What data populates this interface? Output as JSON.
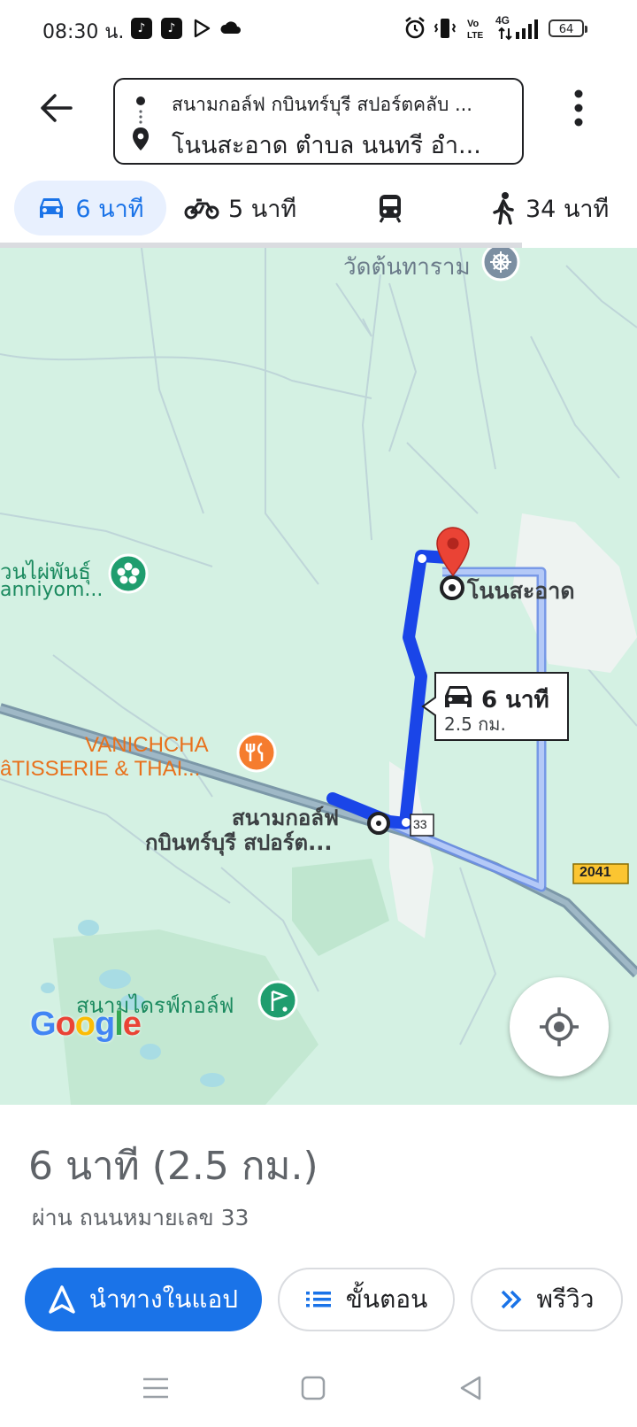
{
  "status_bar": {
    "time": "08:30 น.",
    "network": "4G",
    "battery": "64",
    "app_icons": [
      "tiktok-icon",
      "tiktok-icon",
      "play-icon",
      "cloud-icon"
    ],
    "right_icons": [
      "alarm-icon",
      "vibrate-icon",
      "volte-icon",
      "signal-icon",
      "battery-icon"
    ]
  },
  "header": {
    "origin": "สนามกอล์ฟ กบินทร์บุรี สปอร์ตคลับ ...",
    "destination": "โนนสะอาด ตำบล นนทรี อำ..."
  },
  "modes": [
    {
      "name": "drive",
      "label": "6 นาที",
      "icon": "car-icon",
      "selected": true
    },
    {
      "name": "bike",
      "label": "5 นาที",
      "icon": "motorcycle-icon"
    },
    {
      "name": "transit",
      "label": "",
      "icon": "train-icon"
    },
    {
      "name": "walk",
      "label": "34 นาที",
      "icon": "walk-icon"
    }
  ],
  "map": {
    "labels": {
      "temple": "วัดต้นทาราม",
      "park": "วนไผ่พันธุ์",
      "park_sub": "anniyom...",
      "restaurant": "VANICHCHA",
      "restaurant_sub": "âTISSERIE & THAI...",
      "origin_line1": "สนามกอล์ฟ",
      "origin_line2": "กบินทร์บุรี สปอร์ต...",
      "destination": "โนนสะอาด",
      "driving_range": "สนามไดรฟ์กอล์ฟ",
      "road_33": "33",
      "road_2041": "2041"
    },
    "callout": {
      "time": "6 นาที",
      "distance": "2.5 กม."
    },
    "logo": "Google",
    "route_color": "#1a45e8"
  },
  "sheet": {
    "summary": "6 นาที (2.5 กม.)",
    "via": "ผ่าน ถนนหมายเลข 33",
    "buttons": {
      "navigate": "นำทางในแอป",
      "steps": "ขั้นตอน",
      "preview": "พรีวิว"
    }
  },
  "colors": {
    "accent": "#1a73e8",
    "map_bg": "#d4f1e3",
    "pin": "#ea4335"
  }
}
